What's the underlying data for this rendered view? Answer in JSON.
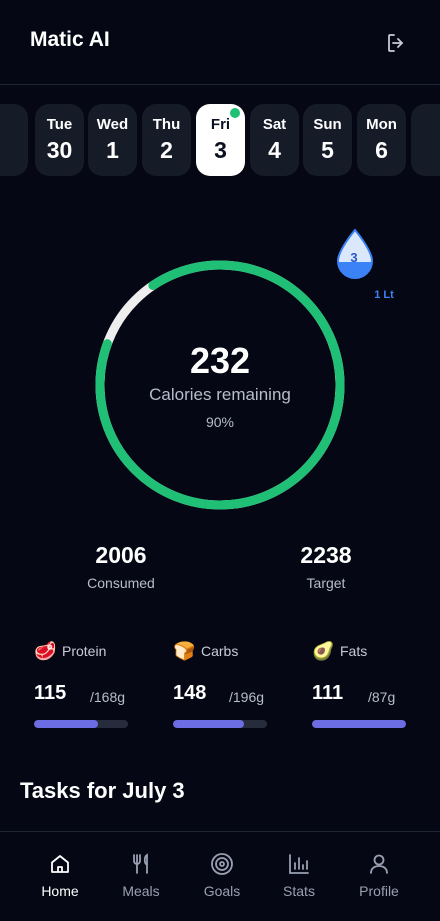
{
  "header": {
    "title": "Matic AI",
    "logout_icon": "logout-icon"
  },
  "days": [
    {
      "name": "Tue",
      "num": "30",
      "selected": false
    },
    {
      "name": "Wed",
      "num": "1",
      "selected": false
    },
    {
      "name": "Thu",
      "num": "2",
      "selected": false
    },
    {
      "name": "Fri",
      "num": "3",
      "selected": true
    },
    {
      "name": "Sat",
      "num": "4",
      "selected": false
    },
    {
      "name": "Sun",
      "num": "5",
      "selected": false
    },
    {
      "name": "Mon",
      "num": "6",
      "selected": false
    }
  ],
  "calories": {
    "remaining": "232",
    "label": "Calories remaining",
    "percent_label": "90%",
    "progress": 0.9
  },
  "water": {
    "count": "3",
    "amount": "1 Lt",
    "icon": "water-drop-icon"
  },
  "stats": {
    "consumed": {
      "value": "2006",
      "label": "Consumed"
    },
    "target": {
      "value": "2238",
      "label": "Target"
    }
  },
  "macros": [
    {
      "emoji": "🥩",
      "name": "Protein",
      "value": "115",
      "goal": "/168g",
      "progress": 0.68
    },
    {
      "emoji": "🍞",
      "name": "Carbs",
      "value": "148",
      "goal": "/196g",
      "progress": 0.76
    },
    {
      "emoji": "🥑",
      "name": "Fats",
      "value": "111",
      "goal": "/87g",
      "progress": 1.0
    }
  ],
  "tasks": {
    "title": "Tasks for July 3"
  },
  "nav": [
    {
      "label": "Home",
      "icon": "home-icon",
      "active": true
    },
    {
      "label": "Meals",
      "icon": "fork-knife-icon",
      "active": false
    },
    {
      "label": "Goals",
      "icon": "target-icon",
      "active": false
    },
    {
      "label": "Stats",
      "icon": "bar-chart-icon",
      "active": false
    },
    {
      "label": "Profile",
      "icon": "user-icon",
      "active": false
    }
  ],
  "colors": {
    "background": "#050814",
    "accent_green": "#1fc075",
    "macro_bar": "#6c6de3",
    "water_blue": "#3b82f6"
  }
}
